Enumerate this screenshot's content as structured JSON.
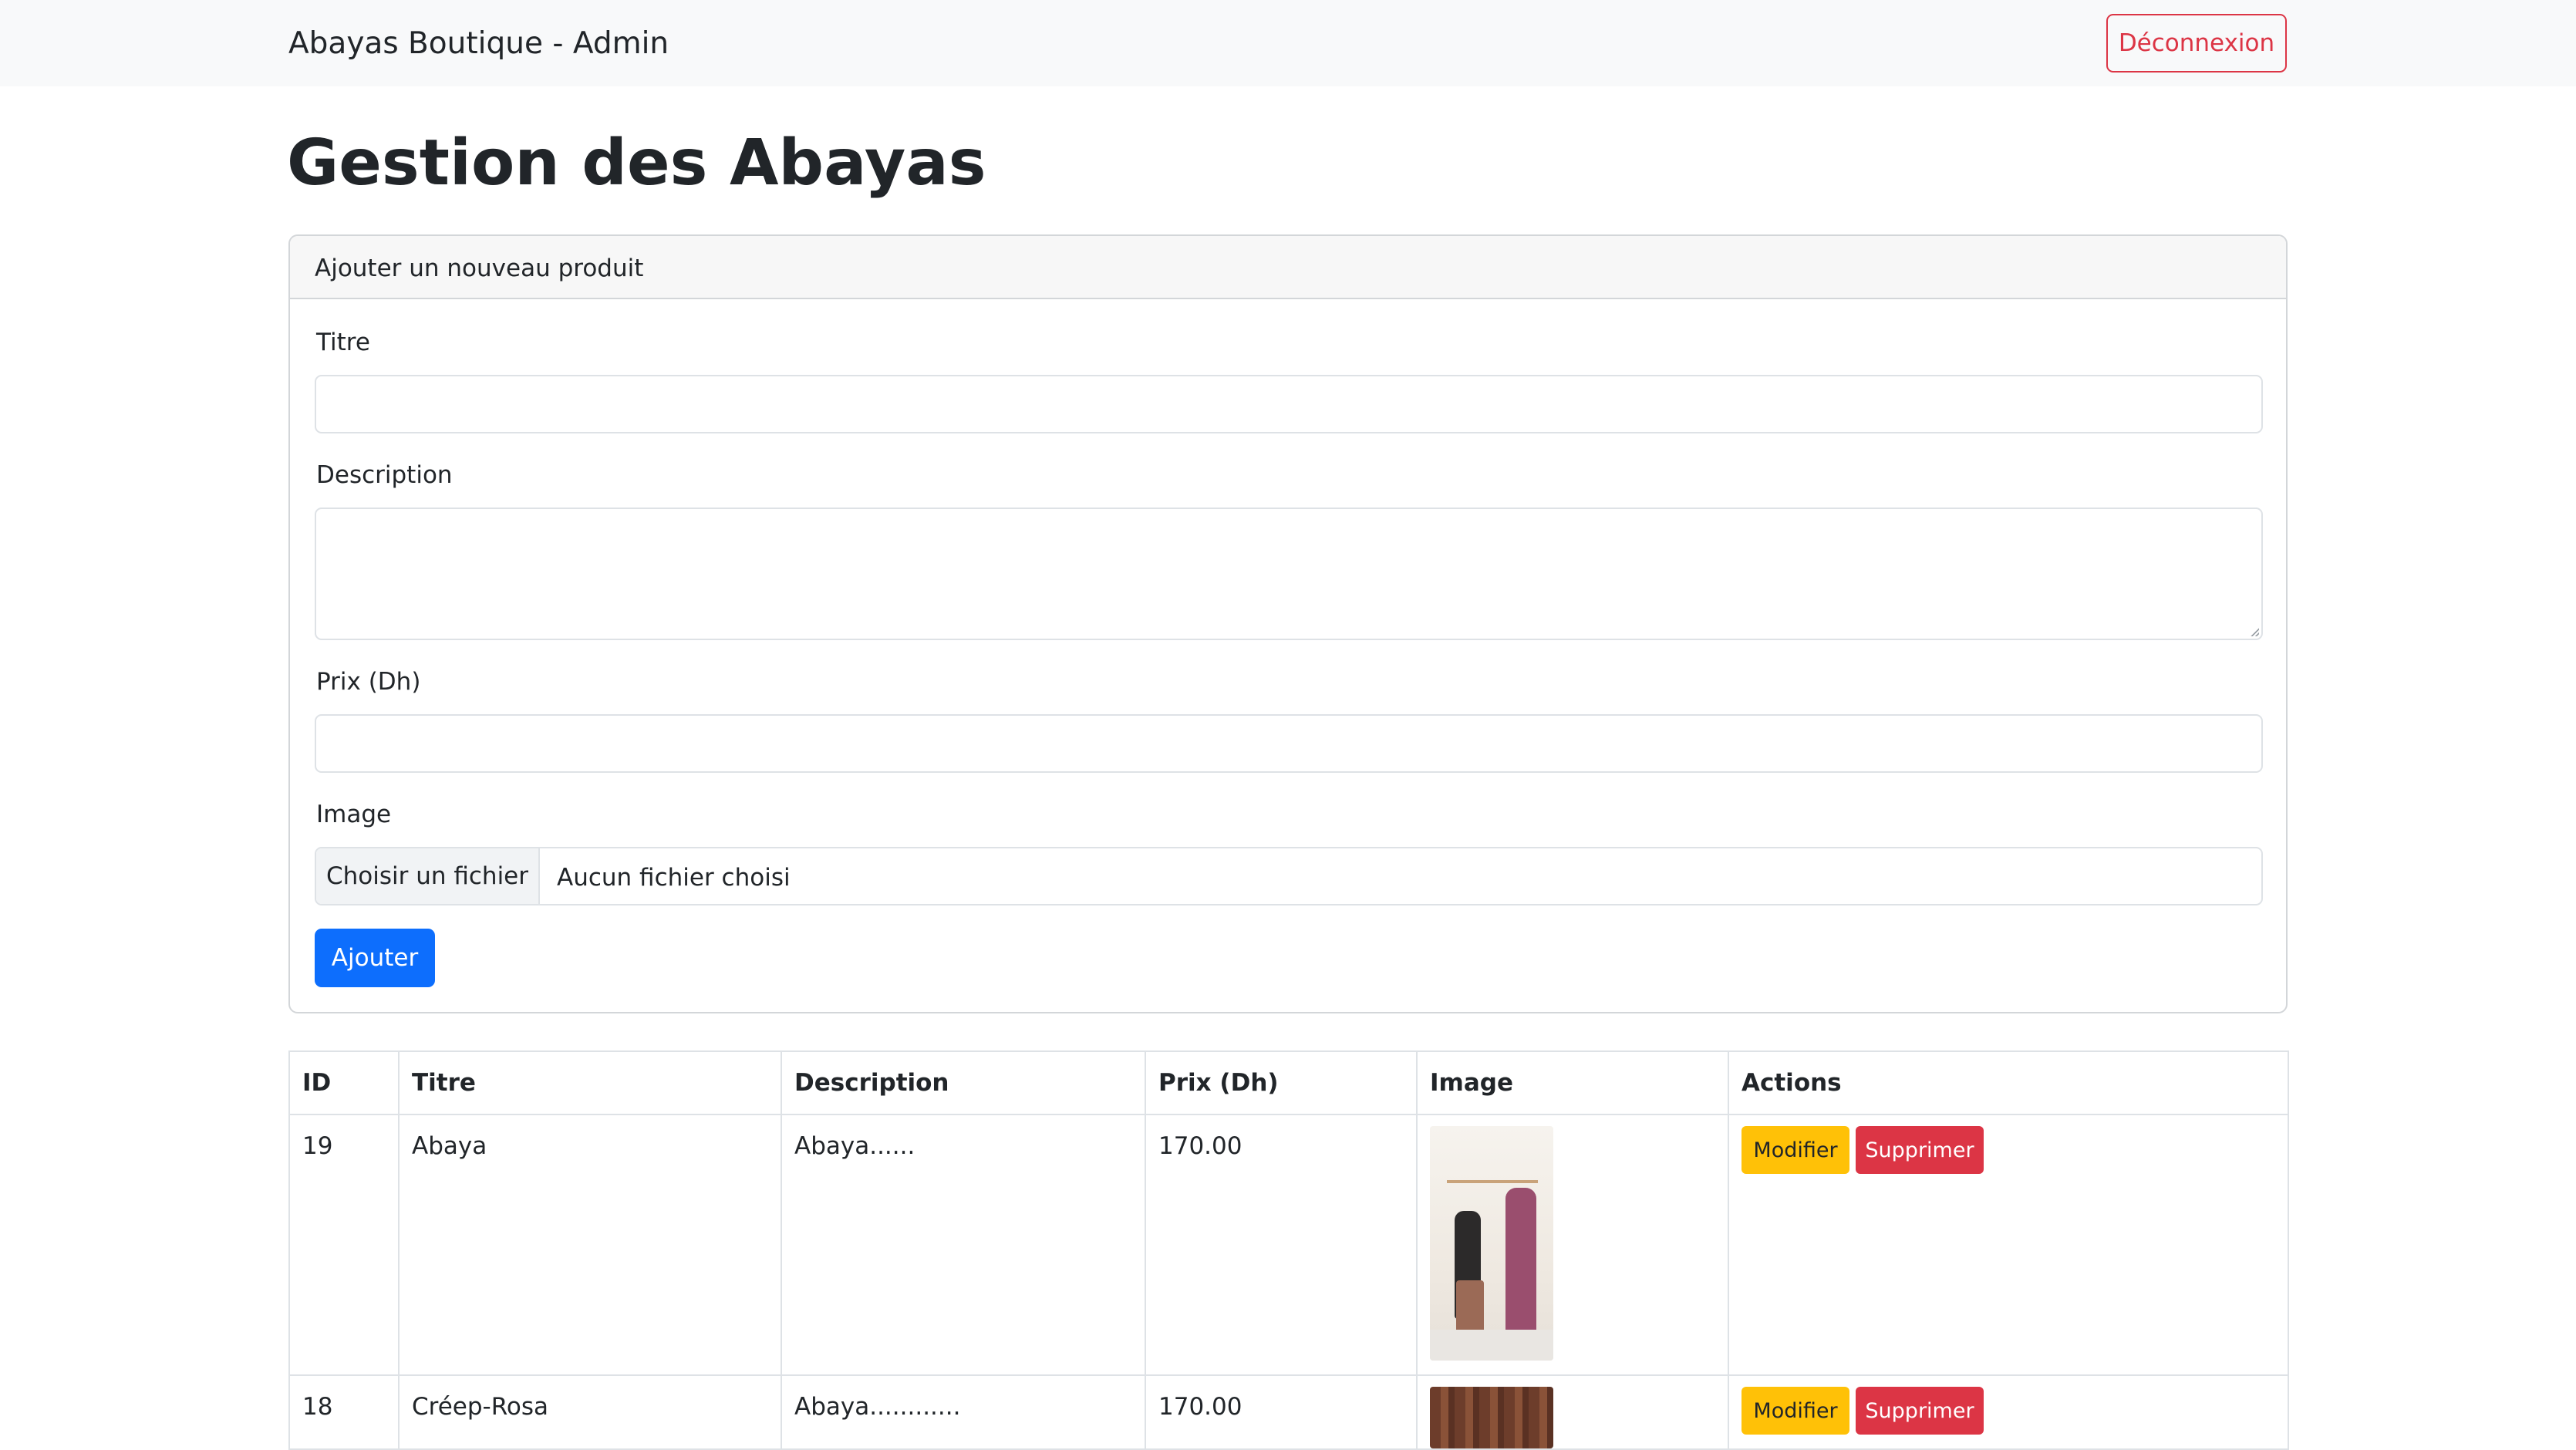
{
  "navbar": {
    "brand": "Abayas Boutique - Admin",
    "logout_label": "Déconnexion"
  },
  "page": {
    "title": "Gestion des Abayas"
  },
  "form": {
    "header": "Ajouter un nouveau produit",
    "title_label": "Titre",
    "title_value": "",
    "description_label": "Description",
    "description_value": "",
    "price_label": "Prix (Dh)",
    "price_value": "",
    "image_label": "Image",
    "file_button_label": "Choisir un fichier",
    "file_status": "Aucun fichier choisi",
    "submit_label": "Ajouter"
  },
  "table": {
    "columns": [
      "ID",
      "Titre",
      "Description",
      "Prix (Dh)",
      "Image",
      "Actions"
    ],
    "rows": [
      {
        "id": "19",
        "titre": "Abaya",
        "description": "Abaya......",
        "prix": "170.00",
        "image": "abaya-photo"
      },
      {
        "id": "18",
        "titre": "Créep-Rosa",
        "description": "Abaya............",
        "prix": "170.00",
        "image": "abaya-photo"
      }
    ],
    "edit_label": "Modifier",
    "delete_label": "Supprimer"
  },
  "colors": {
    "primary": "#0d6efd",
    "danger": "#dc3545",
    "warning": "#ffc107",
    "navbar_bg": "#f8f9fa"
  }
}
